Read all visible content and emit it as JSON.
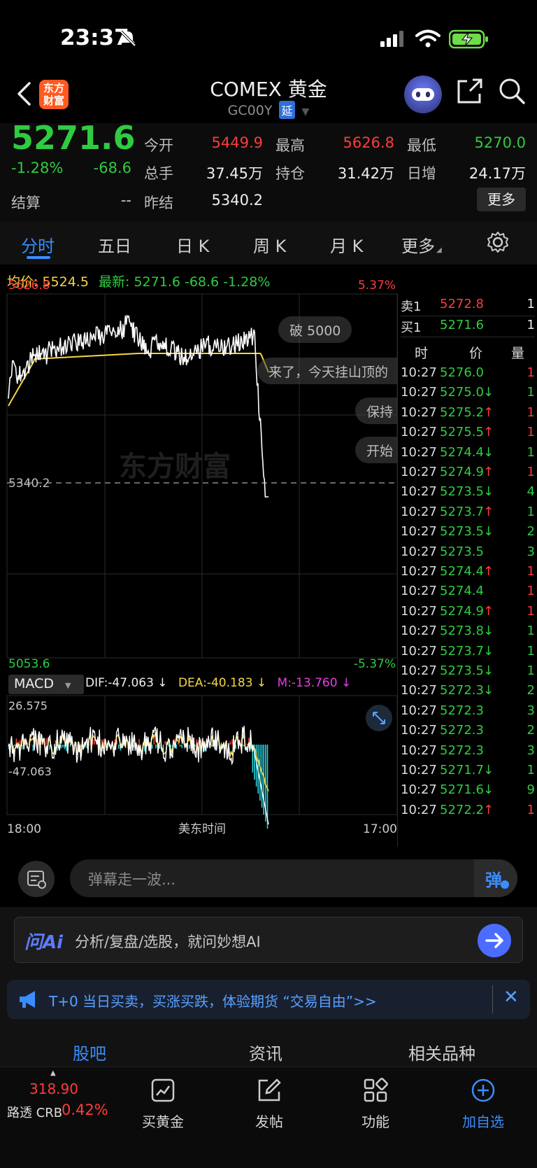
{
  "status_bar": {
    "time": "23:37"
  },
  "header": {
    "title": "COMEX 黄金",
    "code": "GC00Y",
    "delay_badge": "延",
    "brand_logo": "东方财富"
  },
  "quote": {
    "last_price": "5271.6",
    "change_pct": "-1.28%",
    "change": "-68.6",
    "settle_label": "结算",
    "settle_value": "--",
    "open_label": "今开",
    "open_value": "5449.9",
    "high_label": "最高",
    "high_value": "5626.8",
    "low_label": "最低",
    "low_value": "5270.0",
    "volume_label": "总手",
    "volume_value": "37.45万",
    "oi_label": "持仓",
    "oi_value": "31.42万",
    "daily_inc_label": "日增",
    "daily_inc_value": "24.17万",
    "prev_settle_label": "昨结",
    "prev_settle_value": "5340.2",
    "more_button": "更多"
  },
  "tabs": [
    {
      "label": "分时",
      "active": true
    },
    {
      "label": "五日"
    },
    {
      "label": "日 K"
    },
    {
      "label": "周 K"
    },
    {
      "label": "月 K"
    },
    {
      "label": "更多"
    }
  ],
  "legend": {
    "avg_label": "均价:",
    "avg_value": "5524.5",
    "latest_label": "最新:",
    "latest_value": "5271.6",
    "latest_change": "-68.6",
    "latest_pct": "-1.28%"
  },
  "chart": {
    "y_top": "5626.8",
    "y_mid": "5340.2",
    "y_bottom": "5053.6",
    "pct_top": "5.37%",
    "pct_bottom": "-5.37%",
    "watermark": "东方财富",
    "x_start": "18:00",
    "x_mid": "美东时间",
    "x_end": "17:00",
    "colors": {
      "price": "#ffffff",
      "avg": "#f5d742",
      "up": "#ff3b3b",
      "down": "#2ecc40"
    }
  },
  "macd": {
    "selector": "MACD",
    "dif": "DIF:-47.063 ↓",
    "dea": "DEA:-40.183 ↓",
    "m": "M:-13.760 ↓",
    "y_top": "26.575",
    "y_bottom": "-47.063"
  },
  "danmaku": [
    "破 5000",
    "来了，今天挂山顶的",
    "保持",
    "开始"
  ],
  "order_book": {
    "sell_label": "卖1",
    "sell_price": "5272.8",
    "sell_qty": "1",
    "buy_label": "买1",
    "buy_price": "5271.6",
    "buy_qty": "1",
    "col_time": "时",
    "col_price": "价",
    "col_qty": "量",
    "trades": [
      {
        "time": "10:27",
        "price": "5276.0",
        "arrow": "",
        "qty": "1",
        "qc": "red"
      },
      {
        "time": "10:27",
        "price": "5275.0",
        "arrow": "↓",
        "qty": "1",
        "qc": "green"
      },
      {
        "time": "10:27",
        "price": "5275.2",
        "arrow": "↑",
        "qty": "1",
        "qc": "red"
      },
      {
        "time": "10:27",
        "price": "5275.5",
        "arrow": "↑",
        "qty": "1",
        "qc": "red"
      },
      {
        "time": "10:27",
        "price": "5274.4",
        "arrow": "↓",
        "qty": "1",
        "qc": "green"
      },
      {
        "time": "10:27",
        "price": "5274.9",
        "arrow": "↑",
        "qty": "1",
        "qc": "red"
      },
      {
        "time": "10:27",
        "price": "5273.5",
        "arrow": "↓",
        "qty": "4",
        "qc": "green"
      },
      {
        "time": "10:27",
        "price": "5273.7",
        "arrow": "↑",
        "qty": "1",
        "qc": "green"
      },
      {
        "time": "10:27",
        "price": "5273.5",
        "arrow": "↓",
        "qty": "2",
        "qc": "green"
      },
      {
        "time": "10:27",
        "price": "5273.5",
        "arrow": "",
        "qty": "3",
        "qc": "green"
      },
      {
        "time": "10:27",
        "price": "5274.4",
        "arrow": "↑",
        "qty": "1",
        "qc": "red"
      },
      {
        "time": "10:27",
        "price": "5274.4",
        "arrow": "",
        "qty": "1",
        "qc": "red"
      },
      {
        "time": "10:27",
        "price": "5274.9",
        "arrow": "↑",
        "qty": "1",
        "qc": "red"
      },
      {
        "time": "10:27",
        "price": "5273.8",
        "arrow": "↓",
        "qty": "1",
        "qc": "green"
      },
      {
        "time": "10:27",
        "price": "5273.7",
        "arrow": "↓",
        "qty": "1",
        "qc": "green"
      },
      {
        "time": "10:27",
        "price": "5273.5",
        "arrow": "↓",
        "qty": "1",
        "qc": "green"
      },
      {
        "time": "10:27",
        "price": "5272.3",
        "arrow": "↓",
        "qty": "2",
        "qc": "green"
      },
      {
        "time": "10:27",
        "price": "5272.3",
        "arrow": "",
        "qty": "3",
        "qc": "green"
      },
      {
        "time": "10:27",
        "price": "5272.3",
        "arrow": "",
        "qty": "2",
        "qc": "green"
      },
      {
        "time": "10:27",
        "price": "5272.3",
        "arrow": "",
        "qty": "3",
        "qc": "green"
      },
      {
        "time": "10:27",
        "price": "5271.7",
        "arrow": "↓",
        "qty": "1",
        "qc": "green"
      },
      {
        "time": "10:27",
        "price": "5271.6",
        "arrow": "↓",
        "qty": "9",
        "qc": "green"
      },
      {
        "time": "10:27",
        "price": "5272.2",
        "arrow": "↑",
        "qty": "1",
        "qc": "red"
      }
    ]
  },
  "comment_input": {
    "placeholder": "弹幕走一波...",
    "toggle": "弹"
  },
  "ai_bar": {
    "logo": "问Ai",
    "placeholder": "分析/复盘/选股，就问妙想AI"
  },
  "promo": {
    "text": "T+0 当日买卖，买涨买跌，体验期货 “交易自由”>>"
  },
  "section_tabs": [
    {
      "label": "股吧",
      "active": true
    },
    {
      "label": "资讯"
    },
    {
      "label": "相关品种"
    }
  ],
  "bottom_nav": {
    "ticker_value": "318.90",
    "ticker_name": "路透 CRB",
    "ticker_pct": "0.42%",
    "items": [
      {
        "label": "买黄金",
        "icon": "chart-icon"
      },
      {
        "label": "发帖",
        "icon": "edit-icon"
      },
      {
        "label": "功能",
        "icon": "grid-icon"
      },
      {
        "label": "加自选",
        "icon": "plus-circle-icon"
      }
    ]
  }
}
